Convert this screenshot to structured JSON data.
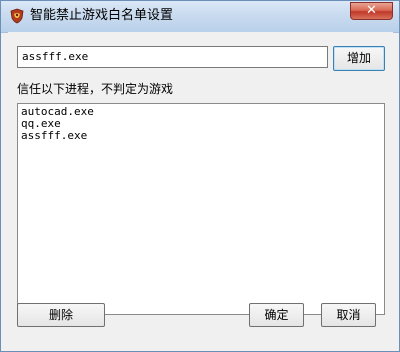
{
  "window": {
    "title": "智能禁止游戏白名单设置",
    "close_label": "✕"
  },
  "input": {
    "value": "assfff.exe"
  },
  "buttons": {
    "add": "增加",
    "delete": "删除",
    "ok": "确定",
    "cancel": "取消"
  },
  "label": "信任以下进程，不判定为游戏",
  "list": {
    "items": [
      "autocad.exe",
      "qq.exe",
      "assfff.exe"
    ]
  },
  "colors": {
    "titlebar": "#c9dbef",
    "close": "#c0392b",
    "background": "#f0f0f0"
  },
  "icons": {
    "app": "shield-eagle-icon",
    "close": "close-icon"
  }
}
